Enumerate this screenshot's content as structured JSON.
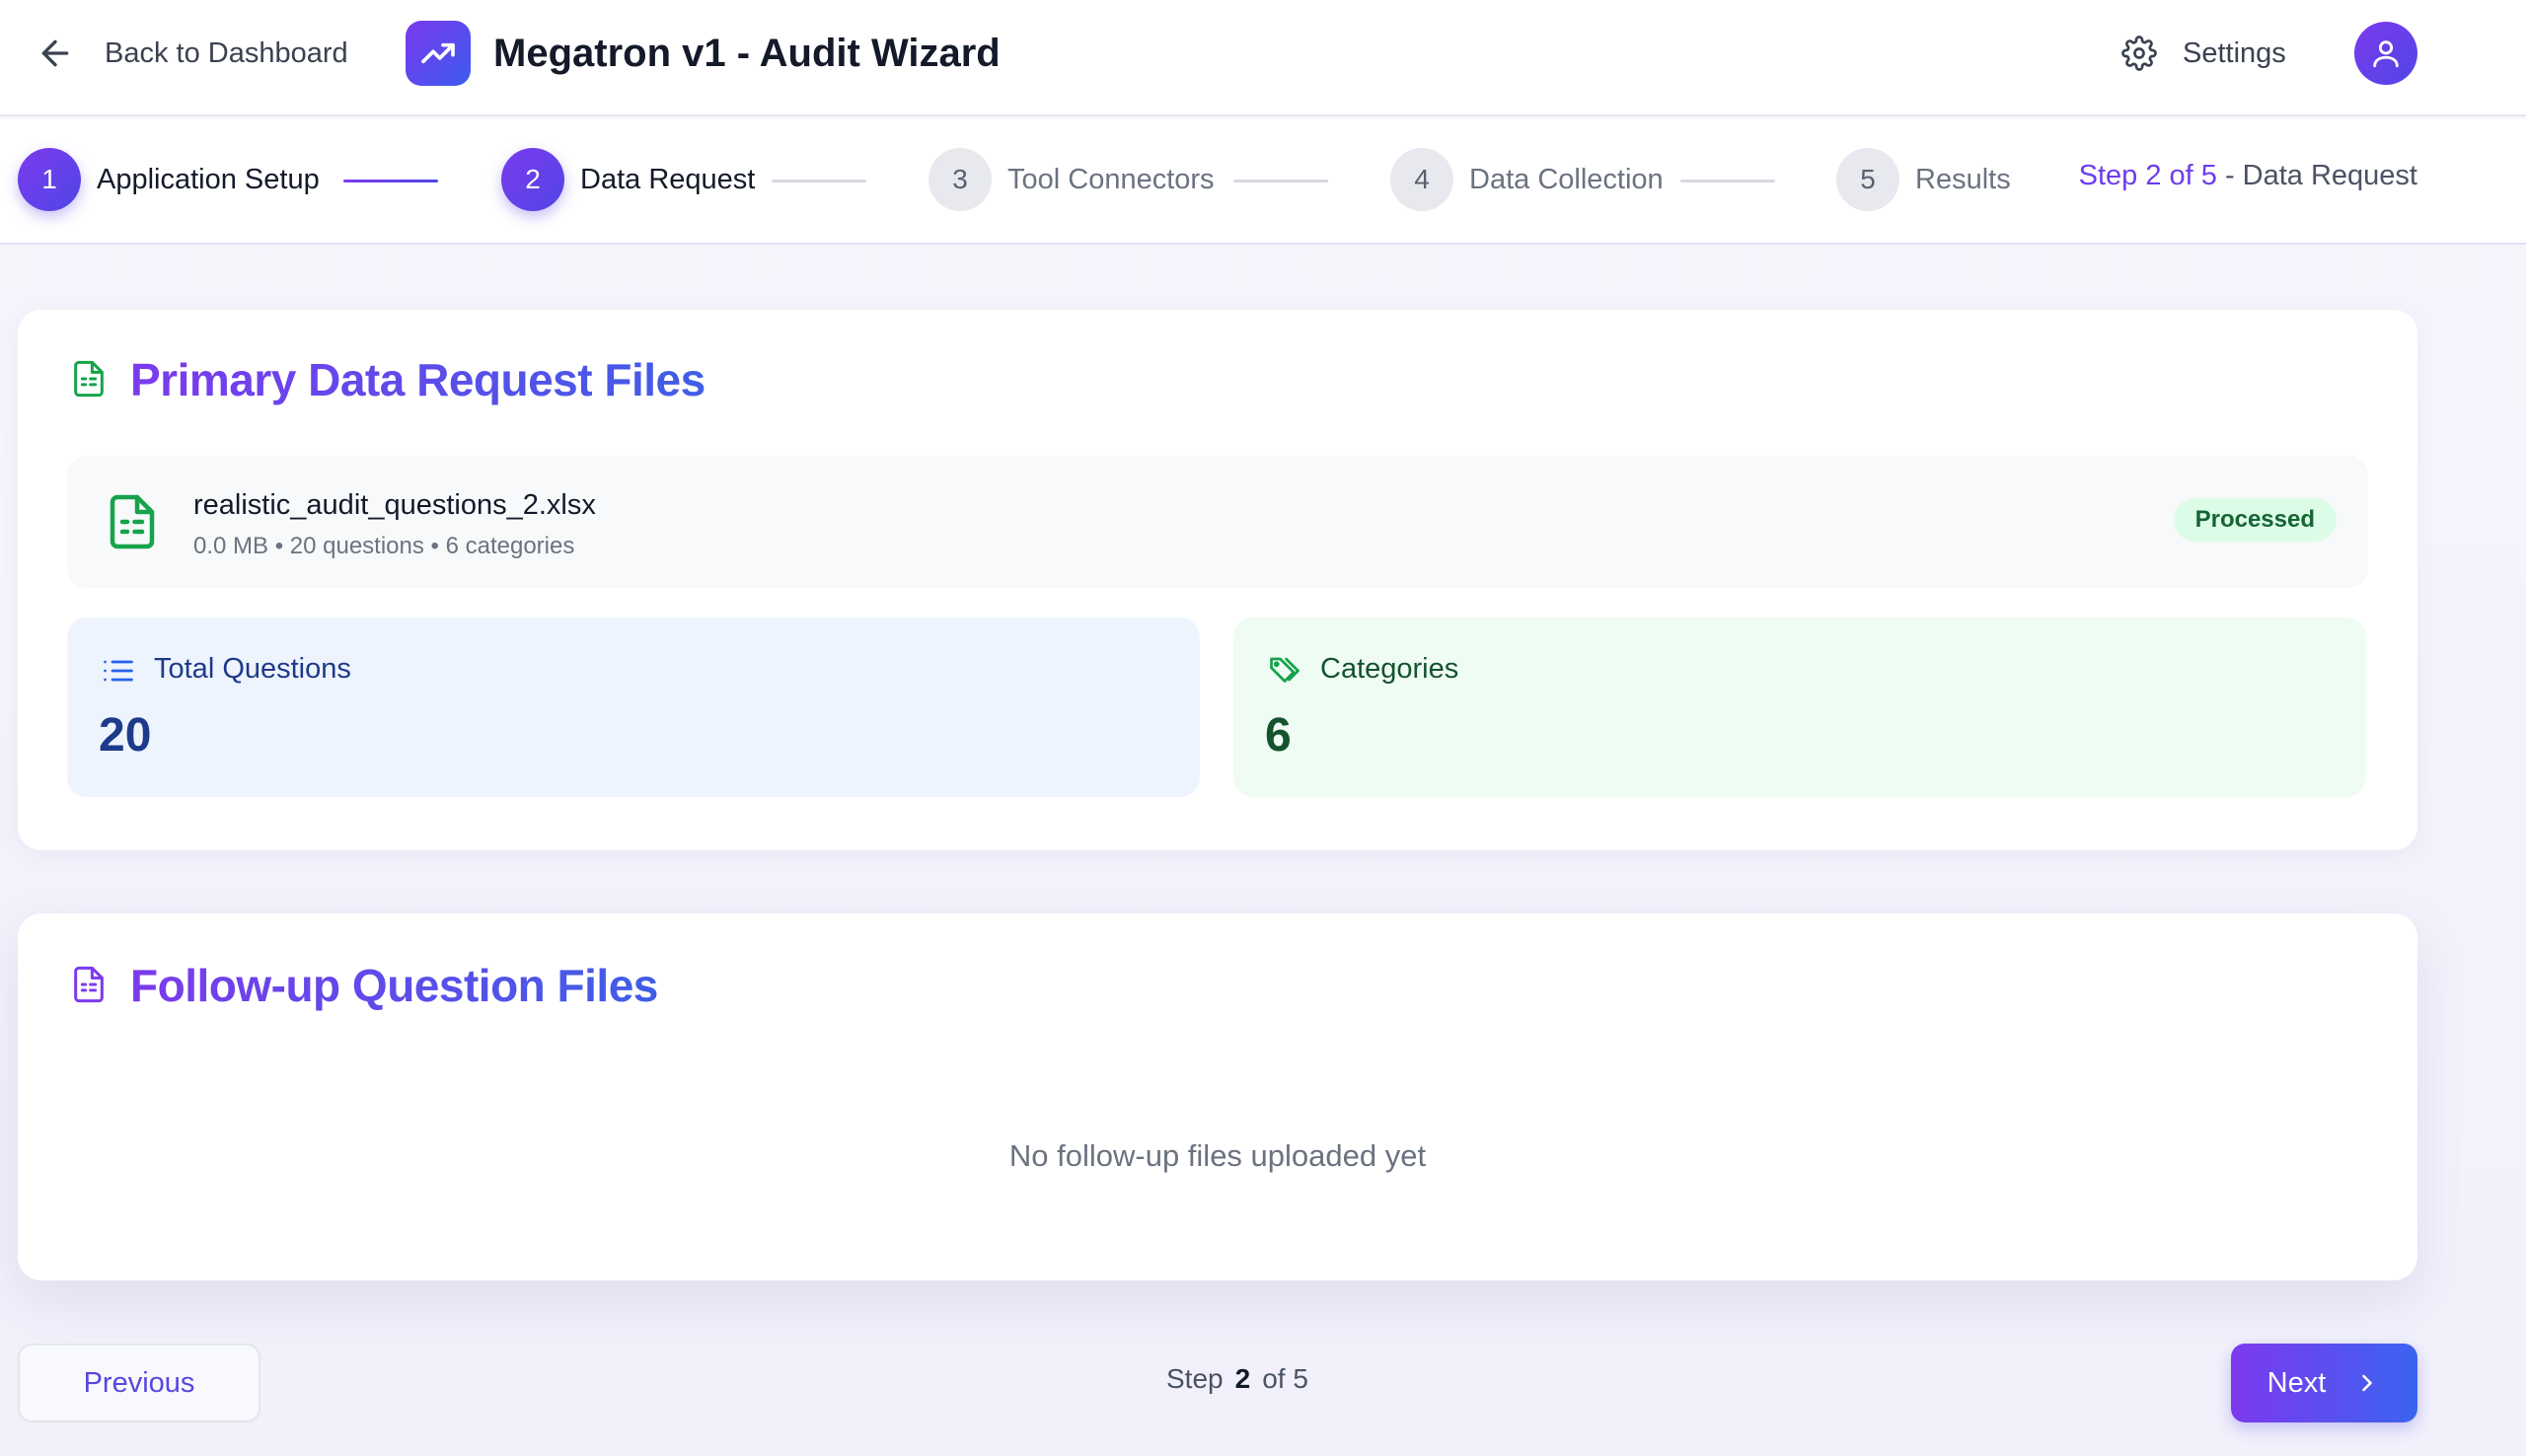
{
  "header": {
    "back_label": "Back to Dashboard",
    "app_title": "Megatron v1 - Audit Wizard",
    "settings_label": "Settings",
    "icons": {
      "back": "arrow-left-icon",
      "logo": "trending-up-icon",
      "settings": "gear-icon",
      "avatar": "user-icon"
    }
  },
  "stepper": {
    "steps": [
      {
        "number": "1",
        "label": "Application Setup",
        "state": "completed"
      },
      {
        "number": "2",
        "label": "Data Request",
        "state": "current"
      },
      {
        "number": "3",
        "label": "Tool Connectors",
        "state": "upcoming"
      },
      {
        "number": "4",
        "label": "Data Collection",
        "state": "upcoming"
      },
      {
        "number": "5",
        "label": "Results",
        "state": "upcoming"
      }
    ],
    "status_prefix": "Step 2 of 5",
    "status_suffix": " - Data Request"
  },
  "primary_files": {
    "title": "Primary Data Request Files",
    "file": {
      "name": "realistic_audit_questions_2.xlsx",
      "meta": "0.0 MB • 20 questions • 6 categories",
      "status": "Processed"
    },
    "stats": {
      "questions_label": "Total Questions",
      "questions_value": "20",
      "categories_label": "Categories",
      "categories_value": "6"
    }
  },
  "followup_files": {
    "title": "Follow-up Question Files",
    "empty_text": "No follow-up files uploaded yet"
  },
  "footer": {
    "previous_label": "Previous",
    "step_word": "Step",
    "current_step": "2",
    "of_total": "of 5",
    "next_label": "Next"
  },
  "colors": {
    "accent_start": "#7c3aed",
    "accent_end": "#3b63f0",
    "success_bg": "#dcfce7",
    "success_text": "#166534"
  }
}
